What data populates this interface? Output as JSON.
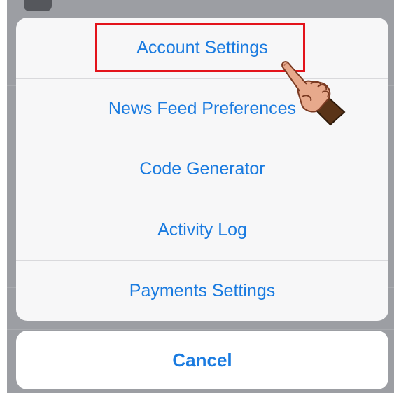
{
  "action_sheet": {
    "options": [
      {
        "label": "Account Settings"
      },
      {
        "label": "News Feed Preferences"
      },
      {
        "label": "Code Generator"
      },
      {
        "label": "Activity Log"
      },
      {
        "label": "Payments Settings"
      }
    ],
    "cancel_label": "Cancel"
  },
  "colors": {
    "accent": "#1a7be0",
    "highlight": "#e3131b",
    "sheet_background": "#f7f7f8",
    "backdrop": "#9c9ea3"
  },
  "annotations": {
    "highlighted_option": "Account Settings",
    "pointer_icon": "pointing-hand-icon"
  }
}
